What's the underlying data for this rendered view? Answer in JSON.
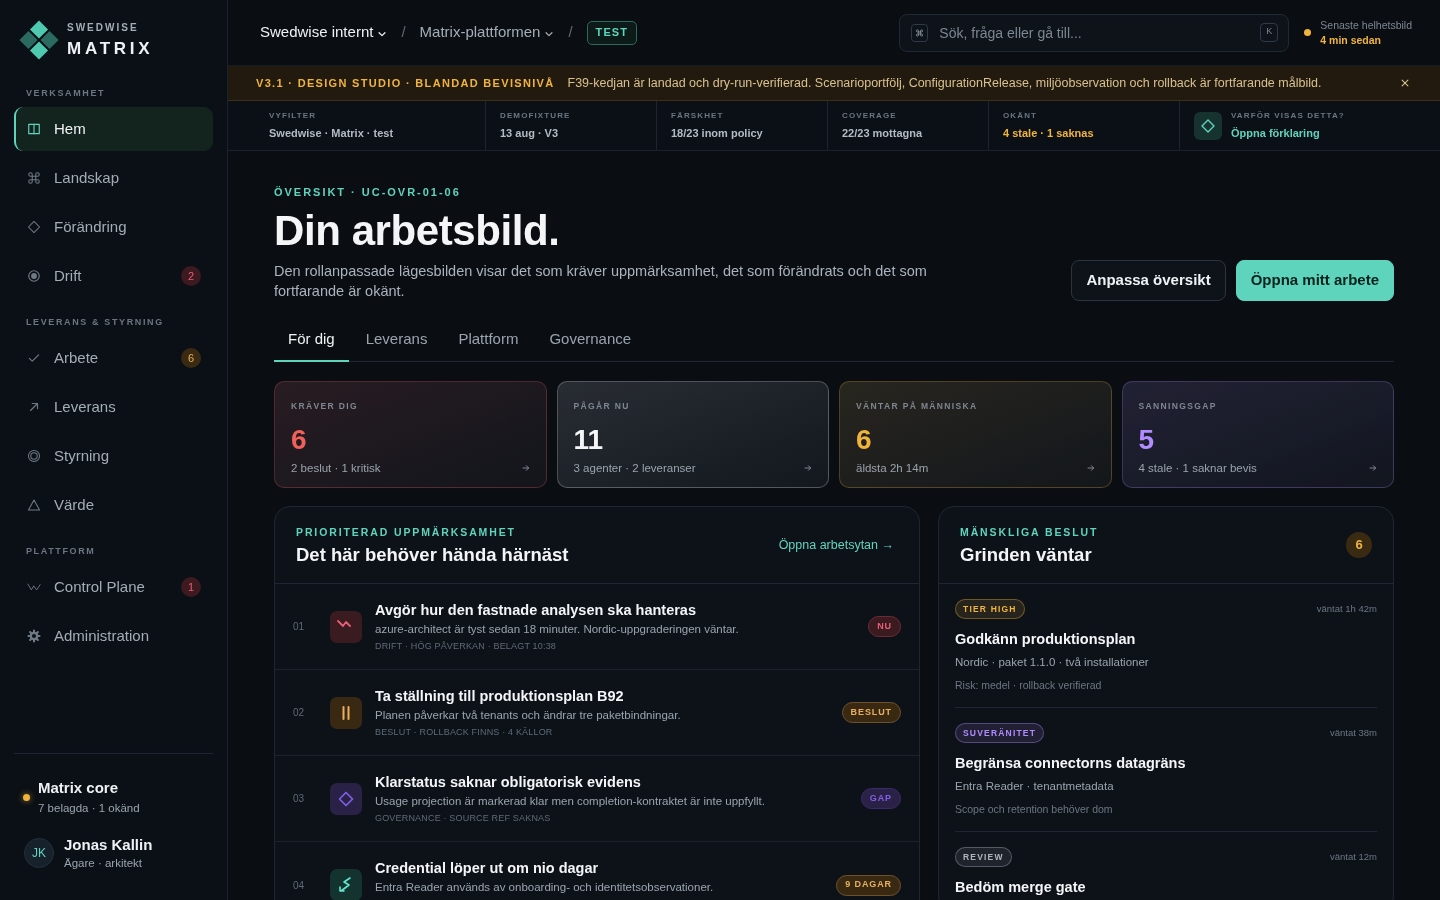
{
  "brand": {
    "eyebrow": "SWEDWISE",
    "name": "MATRIX"
  },
  "sidebar": {
    "sections": [
      {
        "label": "VERKSAMHET",
        "items": [
          {
            "label": "Hem",
            "selected": true
          },
          {
            "label": "Landskap",
            "selected": false
          },
          {
            "label": "Förändring",
            "selected": false
          },
          {
            "label": "Drift",
            "selected": false,
            "badge": {
              "text": "2",
              "color": "#3d1a1f"
            }
          }
        ]
      },
      {
        "label": "LEVERANS & STYRNING",
        "items": [
          {
            "label": "Arbete",
            "selected": false,
            "badge": {
              "text": "6",
              "color": "#3b2a12"
            }
          },
          {
            "label": "Leverans",
            "selected": false
          },
          {
            "label": "Styrning",
            "selected": false
          },
          {
            "label": "Värde",
            "selected": false
          }
        ]
      },
      {
        "label": "PLATTFORM",
        "items": [
          {
            "label": "Control Plane",
            "selected": false,
            "badge": {
              "text": "1",
              "color": "#3d1a1f"
            }
          },
          {
            "label": "Administration",
            "selected": false
          }
        ]
      }
    ],
    "workspace": {
      "name": "Matrix core",
      "detail": "7 belagda · 1 okänd",
      "color": "#f0b43c"
    },
    "user": {
      "initials": "JK",
      "name": "Jonas Kallin",
      "role": "Ägare · arkitekt"
    }
  },
  "topbar": {
    "breadcrumbs": [
      {
        "label": "Swedwise internt",
        "kind": "menu"
      },
      {
        "label": "Matrix-plattformen",
        "kind": "menu"
      },
      {
        "label": "TEST",
        "kind": "tag"
      }
    ],
    "separators": [
      "/",
      "/"
    ],
    "search": {
      "placeholder": "Sök, fråga eller gå till...",
      "shortcut": "K"
    },
    "freshness": {
      "label": "Senaste helhetsbild",
      "value": "4 min sedan",
      "color": "#f0b43c"
    }
  },
  "banner": {
    "label": "V3.1 · DESIGN STUDIO · BLANDAD BEVISNIVÅ",
    "text": "F39-kedjan är landad och dry-run-verifierad. Scenarioportfölj, ConfigurationRelease, miljöobservation och rollback är fortfarande målbild.",
    "dismissible": true
  },
  "info_bar": [
    {
      "label": "VYFILTER",
      "value": "Swedwise · Matrix · test",
      "kind": "text",
      "color": "#b3bbc3"
    },
    {
      "label": "DEMOFIXTURE",
      "value": "13 aug · V3",
      "kind": "text",
      "color": "#b3bbc3"
    },
    {
      "label": "FÄRSKHET",
      "value": "18/23 inom policy",
      "kind": "text",
      "color": "#b3bbc3"
    },
    {
      "label": "COVERAGE",
      "value": "22/23 mottagna",
      "kind": "text",
      "color": "#b3bbc3"
    },
    {
      "label": "OKÄNT",
      "value": "4 stale · 1 saknas",
      "kind": "text",
      "color": "#f0b43c"
    },
    {
      "label": "VARFÖR VISAS DETTA?",
      "value": "Öppna förklaring",
      "kind": "link",
      "color": "#5fd4bd"
    }
  ],
  "overview": {
    "eyebrow": "ÖVERSIKT · UC-OVR-01-06",
    "title": "Din arbetsbild.",
    "description": "Den rollanpassade lägesbilden visar det som kräver uppmärksamhet, det som förändrats och det som fortfarande är okänt.",
    "actions": [
      {
        "label": "Anpassa översikt",
        "kind": "secondary"
      },
      {
        "label": "Öppna mitt arbete",
        "kind": "primary"
      }
    ]
  },
  "tabs": [
    {
      "label": "För dig",
      "selected": true
    },
    {
      "label": "Leverans",
      "selected": false
    },
    {
      "label": "Plattform",
      "selected": false
    },
    {
      "label": "Governance",
      "selected": false
    }
  ],
  "stats": [
    {
      "label": "KRÄVER DIG",
      "value": "6",
      "detail": "2 beslut · 1 kritisk",
      "color": "#f0605a"
    },
    {
      "label": "PÅGÅR NU",
      "value": "11",
      "detail": "3 agenter · 2 leveranser",
      "color": "#f3f5f7"
    },
    {
      "label": "VÄNTAR PÅ MÄNNISKA",
      "value": "6",
      "detail": "äldsta 2h 14m",
      "color": "#f0b43c"
    },
    {
      "label": "SANNINGSGAP",
      "value": "5",
      "detail": "4 stale · 1 saknar bevis",
      "color": "#b18cff"
    }
  ],
  "attention": {
    "eyebrow": "PRIORITERAD UPPMÄRKSAMHET",
    "title": "Det här behöver hända härnäst",
    "link": "Öppna arbetsytan →",
    "items": [
      {
        "number": "01",
        "title": "Avgör hur den fastnade analysen ska hanteras",
        "description": "azure-architect är tyst sedan 18 minuter. Nordic-uppgraderingen väntar.",
        "meta": "DRIFT · HÖG PÅVERKAN · BELAGT 10:38",
        "color": "#3a1b20",
        "badge": {
          "text": "NU",
          "color": "#3b1a20"
        }
      },
      {
        "number": "02",
        "title": "Ta ställning till produktionsplan B92",
        "description": "Planen påverkar två tenants och ändrar tre paketbindningar.",
        "meta": "BESLUT · ROLLBACK FINNS · 4 KÄLLOR",
        "color": "#3a2912",
        "badge": {
          "text": "BESLUT",
          "color": "#3a2912"
        }
      },
      {
        "number": "03",
        "title": "Klarstatus saknar obligatorisk evidens",
        "description": "Usage projection är markerad klar men completion-kontraktet är inte uppfyllt.",
        "meta": "GOVERNANCE · SOURCE REF SAKNAS",
        "color": "#2a2146",
        "badge": {
          "text": "GAP",
          "color": "#2a2146"
        }
      },
      {
        "number": "04",
        "title": "Credential löper ut om nio dagar",
        "description": "Entra Reader används av onboarding- och identitetsobservationer.",
        "color": "#15332e",
        "badge": {
          "text": "9 DAGAR",
          "color": "#3a2912"
        }
      }
    ]
  },
  "decisions": {
    "eyebrow": "MÄNSKLIGA BESLUT",
    "title": "Grinden väntar",
    "count": "6",
    "items": [
      {
        "tag": {
          "text": "TIER HIGH",
          "color": "#f0b43c"
        },
        "waited": "väntat 1h 42m",
        "title": "Godkänn produktionsplan",
        "detail": "Nordic · paket 1.1.0 · två installationer",
        "note": "Risk: medel · rollback verifierad"
      },
      {
        "tag": {
          "text": "SUVERÄNITET",
          "color": "#b18cff"
        },
        "waited": "väntat 38m",
        "title": "Begränsa connectorns datagräns",
        "detail": "Entra Reader · tenantmetadata",
        "note": "Scope och retention behöver dom"
      },
      {
        "tag": {
          "text": "REVIEW",
          "color": "#aeb6be"
        },
        "waited": "väntat 12m",
        "title": "Bedöm merge gate"
      }
    ]
  }
}
